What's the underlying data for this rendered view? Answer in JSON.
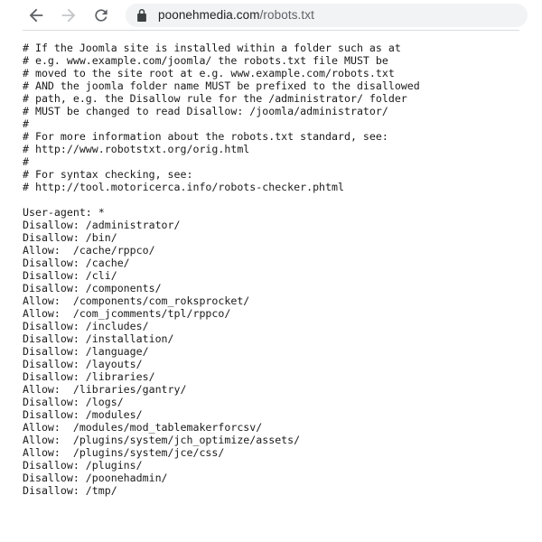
{
  "browser": {
    "back_label": "Back",
    "forward_label": "Forward",
    "reload_label": "Reload",
    "back_icon": "arrow-left-icon",
    "forward_icon": "arrow-right-icon",
    "reload_icon": "reload-icon",
    "security_icon": "lock-icon",
    "url_domain": "poonehmedia.com",
    "url_path": "/robots.txt",
    "url_full": "poonehmedia.com/robots.txt",
    "colors": {
      "omnibox_background": "#f1f3f4",
      "icon_active": "#5f6368",
      "icon_disabled": "#bdc1c6",
      "url_domain_color": "#202124",
      "url_path_color": "#5f6368",
      "separator": "#dadce0",
      "page_background": "#ffffff",
      "text_color": "#1a1a1a"
    }
  },
  "page": {
    "content_type": "text/plain",
    "lines": [
      "# If the Joomla site is installed within a folder such as at",
      "# e.g. www.example.com/joomla/ the robots.txt file MUST be",
      "# moved to the site root at e.g. www.example.com/robots.txt",
      "# AND the joomla folder name MUST be prefixed to the disallowed",
      "# path, e.g. the Disallow rule for the /administrator/ folder",
      "# MUST be changed to read Disallow: /joomla/administrator/",
      "#",
      "# For more information about the robots.txt standard, see:",
      "# http://www.robotstxt.org/orig.html",
      "#",
      "# For syntax checking, see:",
      "# http://tool.motoricerca.info/robots-checker.phtml",
      "",
      "User-agent: *",
      "Disallow: /administrator/",
      "Disallow: /bin/",
      "Allow:  /cache/rppco/",
      "Disallow: /cache/",
      "Disallow: /cli/",
      "Disallow: /components/",
      "Allow:  /components/com_roksprocket/",
      "Allow:  /com_jcomments/tpl/rppco/",
      "Disallow: /includes/",
      "Disallow: /installation/",
      "Disallow: /language/",
      "Disallow: /layouts/",
      "Disallow: /libraries/",
      "Allow:  /libraries/gantry/",
      "Disallow: /logs/",
      "Disallow: /modules/",
      "Allow:  /modules/mod_tablemakerforcsv/",
      "Allow:  /plugins/system/jch_optimize/assets/",
      "Allow:  /plugins/system/jce/css/",
      "Disallow: /plugins/",
      "Disallow: /poonehadmin/",
      "Disallow: /tmp/"
    ]
  }
}
